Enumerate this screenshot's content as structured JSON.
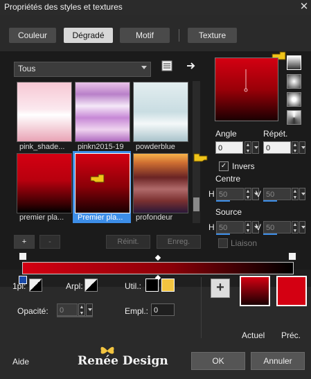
{
  "window": {
    "title": "Propriétés des styles et textures",
    "close_glyph": "✕"
  },
  "tabs": [
    {
      "label": "Couleur"
    },
    {
      "label": "Dégradé",
      "active": true
    },
    {
      "label": "Motif"
    },
    {
      "label": "Texture"
    }
  ],
  "category": {
    "selected": "Tous"
  },
  "gradients": [
    {
      "name": "pink_shade..."
    },
    {
      "name": "pinkn2015-19"
    },
    {
      "name": "powderblue"
    },
    {
      "name": "premier pla..."
    },
    {
      "name": "Premier pla...",
      "selected": true
    },
    {
      "name": "profondeur"
    }
  ],
  "gradient_buttons": {
    "add": "+",
    "remove": "-",
    "reset": "Réinit.",
    "save": "Enreg."
  },
  "settings": {
    "angle_label": "Angle",
    "angle_value": "0",
    "repeat_label": "Répét.",
    "repeat_value": "0",
    "invert_label": "Invers",
    "invert_checked": true,
    "centre_label": "Centre",
    "centre_h_label": "H",
    "centre_h": "50",
    "centre_v_label": "V",
    "centre_v": "50",
    "source_label": "Source",
    "source_h_label": "H",
    "source_h": "50",
    "source_v_label": "V",
    "source_v": "50",
    "link_label": "Liaison"
  },
  "stops": {
    "opl_label": "1pl:",
    "arpl_label": "Arpl:",
    "util_label": "Util.:",
    "opacity_label": "Opacité:",
    "opacity_value": "0",
    "location_label": "Empl.:",
    "location_value": "0"
  },
  "swatches": {
    "add": "+",
    "current_label": "Actuel",
    "previous_label": "Préc.",
    "util_colors": [
      "#000000",
      "#f2c440"
    ],
    "previous_color": "#d40012"
  },
  "footer": {
    "help": "Aide",
    "watermark": "Renée Design",
    "ok": "OK",
    "cancel": "Annuler"
  },
  "colors": {
    "accent": "#3d8ee8",
    "gradient_start": "#d40012",
    "gradient_end": "#000000"
  }
}
